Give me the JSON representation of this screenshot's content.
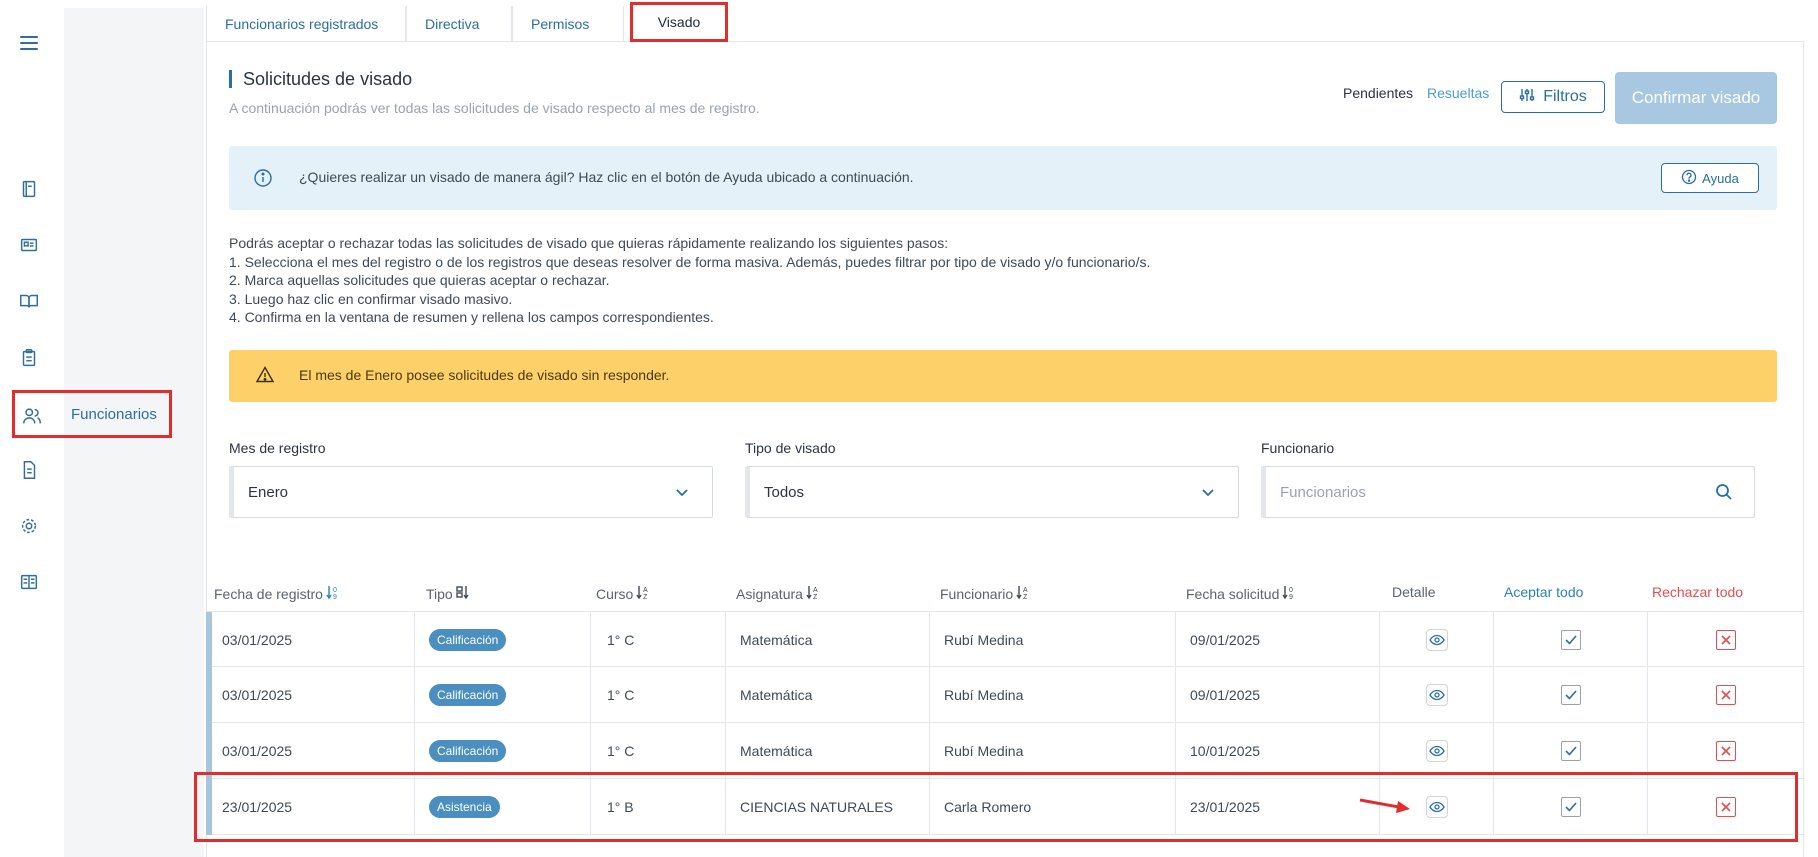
{
  "sidebar": {
    "active_item_label": "Funcionarios",
    "icons": [
      "menu-icon",
      "book-icon",
      "id-card-icon",
      "open-book-icon",
      "clipboard-icon",
      "users-icon",
      "document-icon",
      "gear-icon",
      "guide-icon"
    ]
  },
  "tabs": [
    {
      "label": "Funcionarios registrados"
    },
    {
      "label": "Directiva"
    },
    {
      "label": "Permisos"
    },
    {
      "label": "Visado"
    }
  ],
  "header": {
    "title": "Solicitudes de visado",
    "subtitle": "A continuación podrás ver todas las solicitudes de visado respecto al mes de registro.",
    "pending_label": "Pendientes",
    "resolved_label": "Resueltas",
    "filters_label": "Filtros",
    "confirm_label": "Confirmar visado"
  },
  "info_banner": {
    "text": "¿Quieres realizar un visado de manera ágil? Haz clic en el botón de Ayuda ubicado a continuación.",
    "help_label": "Ayuda"
  },
  "steps": [
    "Podrás aceptar o rechazar todas las solicitudes de visado que quieras rápidamente realizando los siguientes pasos:",
    "1. Selecciona el mes del registro o de los registros que deseas resolver de forma masiva. Además, puedes filtrar por tipo de visado y/o funcionario/s.",
    "2. Marca aquellas solicitudes que quieras aceptar o rechazar.",
    "3. Luego haz clic en confirmar visado masivo.",
    "4. Confirma en la ventana de resumen y rellena los campos correspondientes."
  ],
  "warning_banner": {
    "text": "El mes de Enero posee solicitudes de visado sin responder."
  },
  "filters": {
    "month_label": "Mes de registro",
    "month_value": "Enero",
    "type_label": "Tipo de visado",
    "type_value": "Todos",
    "staff_label": "Funcionario",
    "staff_placeholder": "Funcionarios"
  },
  "table": {
    "headers": {
      "fecha_registro": "Fecha de registro",
      "tipo": "Tipo",
      "curso": "Curso",
      "asignatura": "Asignatura",
      "funcionario": "Funcionario",
      "fecha_solicitud": "Fecha solicitud",
      "detalle": "Detalle",
      "aceptar": "Aceptar todo",
      "rechazar": "Rechazar todo"
    },
    "rows": [
      {
        "fecha": "03/01/2025",
        "tipo": "Calificación",
        "curso": "1° C",
        "asignatura": "Matemática",
        "funcionario": "Rubí Medina",
        "solicitud": "09/01/2025"
      },
      {
        "fecha": "03/01/2025",
        "tipo": "Calificación",
        "curso": "1° C",
        "asignatura": "Matemática",
        "funcionario": "Rubí Medina",
        "solicitud": "09/01/2025"
      },
      {
        "fecha": "03/01/2025",
        "tipo": "Calificación",
        "curso": "1° C",
        "asignatura": "Matemática",
        "funcionario": "Rubí Medina",
        "solicitud": "10/01/2025"
      },
      {
        "fecha": "23/01/2025",
        "tipo": "Asistencia",
        "curso": "1° B",
        "asignatura": "CIENCIAS NATURALES",
        "funcionario": "Carla Romero",
        "solicitud": "23/01/2025"
      }
    ]
  },
  "colors": {
    "accent": "#2a6fa0",
    "highlight": "#e12d2d",
    "warning": "#fdd06a",
    "info": "#e4f1f8",
    "badge": "#4a8fbf"
  }
}
